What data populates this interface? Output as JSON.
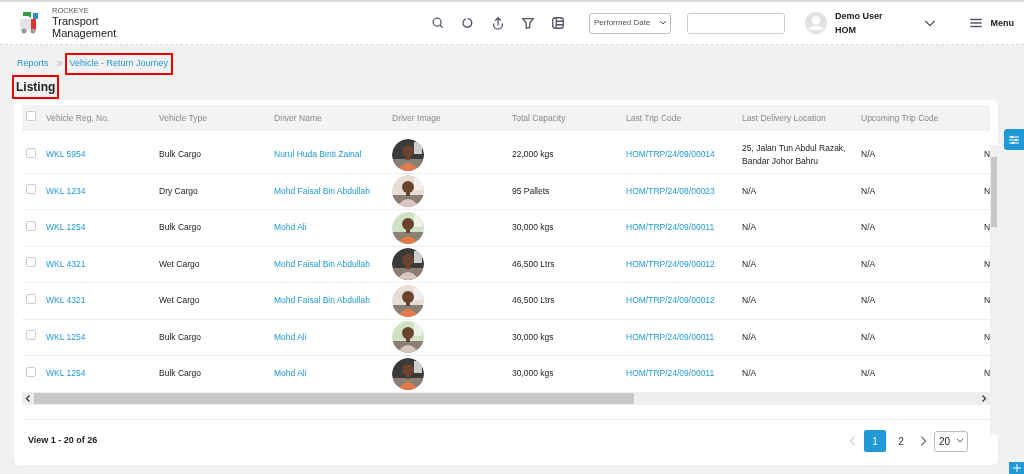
{
  "app": {
    "brand_small": "ROCKEYE",
    "brand": "Transport Management"
  },
  "toolbar": {
    "date_filter": "Performed Date",
    "user": {
      "name": "Demo User",
      "branch": "HOM"
    },
    "menu_label": "Menu"
  },
  "breadcrumb": [
    {
      "label": "Reports",
      "highlighted": false
    },
    {
      "label": "Vehicle - Return Journey",
      "highlighted": true
    }
  ],
  "page_title": {
    "text": "Listing",
    "highlighted": true
  },
  "table": {
    "all_checked": false,
    "columns": [
      "Vehicle Reg. No.",
      "Vehicle Type",
      "Driver Name",
      "Driver Image",
      "Total Capacity",
      "Last Trip Code",
      "Last Delivery Location",
      "Upcoming Trip Code"
    ],
    "rows": [
      {
        "checked": false,
        "vehicle_reg": "WKL 5954",
        "vehicle_type": "Bulk Cargo",
        "driver_name": "Nurul Huda Binti Zainal",
        "total_capacity": "22,000 kgs",
        "last_trip_code": "HOM/TRP/24/09/00014",
        "last_delivery_location": "25, Jalan Tun Abdul Razak, Bandar Johor Bahru",
        "upcoming_trip_code": "N/A",
        "column_9": "N"
      },
      {
        "checked": false,
        "vehicle_reg": "WKL 1234",
        "vehicle_type": "Dry Cargo",
        "driver_name": "Mohd Faisal Bin Abdullah",
        "total_capacity": "95 Pallets",
        "last_trip_code": "HOM/TRP/24/08/00023",
        "last_delivery_location": "N/A",
        "upcoming_trip_code": "N/A",
        "column_9": "N"
      },
      {
        "checked": false,
        "vehicle_reg": "WKL 1254",
        "vehicle_type": "Bulk Cargo",
        "driver_name": "Mohd Ali",
        "total_capacity": "30,000 kgs",
        "last_trip_code": "HOM/TRP/24/09/00011",
        "last_delivery_location": "N/A",
        "upcoming_trip_code": "N/A",
        "column_9": "N"
      },
      {
        "checked": false,
        "vehicle_reg": "WKL 4321",
        "vehicle_type": "Wet Cargo",
        "driver_name": "Mohd Faisal Bin Abdullah",
        "total_capacity": "46,500 Ltrs",
        "last_trip_code": "HOM/TRP/24/09/00012",
        "last_delivery_location": "N/A",
        "upcoming_trip_code": "N/A",
        "column_9": "N"
      },
      {
        "checked": false,
        "vehicle_reg": "WKL 4321",
        "vehicle_type": "Wet Cargo",
        "driver_name": "Mohd Faisal Bin Abdullah",
        "total_capacity": "46,500 Ltrs",
        "last_trip_code": "HOM/TRP/24/09/00012",
        "last_delivery_location": "N/A",
        "upcoming_trip_code": "N/A",
        "column_9": "N"
      },
      {
        "checked": false,
        "vehicle_reg": "WKL 1254",
        "vehicle_type": "Bulk Cargo",
        "driver_name": "Mohd Ali",
        "total_capacity": "30,000 kgs",
        "last_trip_code": "HOM/TRP/24/09/00011",
        "last_delivery_location": "N/A",
        "upcoming_trip_code": "N/A",
        "column_9": "N"
      },
      {
        "checked": false,
        "vehicle_reg": "WKL 1254",
        "vehicle_type": "Bulk Cargo",
        "driver_name": "Mohd Ali",
        "total_capacity": "30,000 kgs",
        "last_trip_code": "HOM/TRP/24/09/00011",
        "last_delivery_location": "N/A",
        "upcoming_trip_code": "N/A",
        "column_9": "N"
      }
    ]
  },
  "footer": {
    "summary": "View 1 - 20 of 26",
    "pages": [
      {
        "label": "1",
        "selected": true
      },
      {
        "label": "2",
        "selected": false
      }
    ],
    "page_size": "20"
  }
}
